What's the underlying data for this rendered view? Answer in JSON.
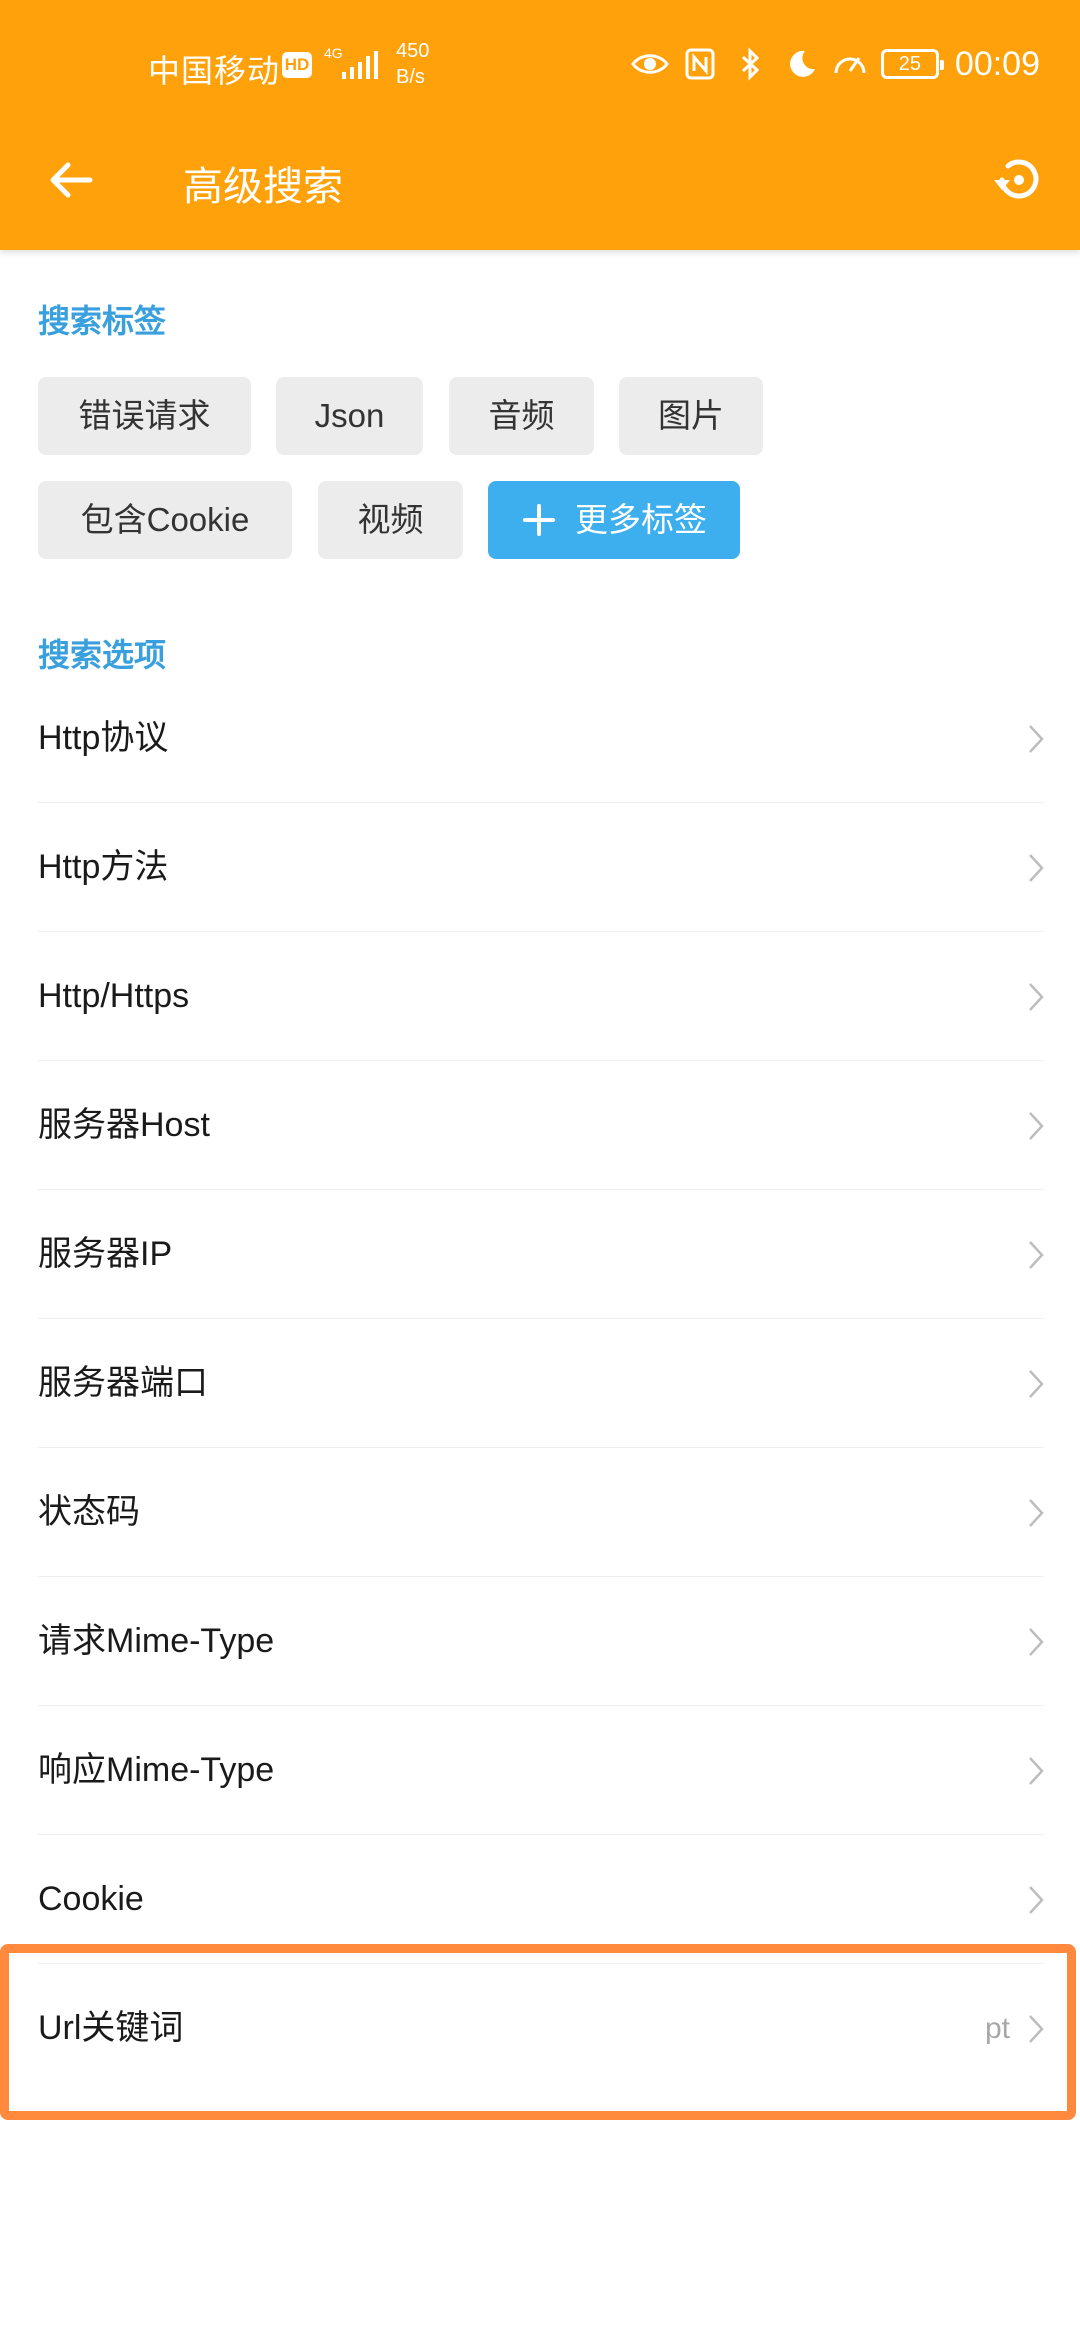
{
  "status_bar": {
    "carrier": "中国移动",
    "hd": "HD",
    "net_type": "4G",
    "speed_value": "450",
    "speed_unit": "B/s",
    "battery": "25",
    "time": "00:09"
  },
  "toolbar": {
    "title": "高级搜索",
    "back_icon": "arrow-left-icon",
    "reset_icon": "history-reset-icon"
  },
  "search_tags": {
    "header": "搜索标签",
    "tags": [
      "错误请求",
      "Json",
      "音频",
      "图片",
      "包含Cookie",
      "视频"
    ],
    "more_label": "更多标签"
  },
  "search_options": {
    "header": "搜索选项",
    "items": [
      {
        "label": "Http协议",
        "value": ""
      },
      {
        "label": "Http方法",
        "value": ""
      },
      {
        "label": "Http/Https",
        "value": ""
      },
      {
        "label": "服务器Host",
        "value": ""
      },
      {
        "label": "服务器IP",
        "value": ""
      },
      {
        "label": "服务器端口",
        "value": ""
      },
      {
        "label": "状态码",
        "value": ""
      },
      {
        "label": "请求Mime-Type",
        "value": ""
      },
      {
        "label": "响应Mime-Type",
        "value": ""
      },
      {
        "label": "Cookie",
        "value": ""
      },
      {
        "label": "Url关键词",
        "value": "pt"
      }
    ]
  },
  "colors": {
    "toolbar": "#FFA10A",
    "accent": "#3AA0DD",
    "more_tag": "#3DAFEE",
    "tag_bg": "#ECECEC",
    "highlight": "#FF8A3D"
  }
}
